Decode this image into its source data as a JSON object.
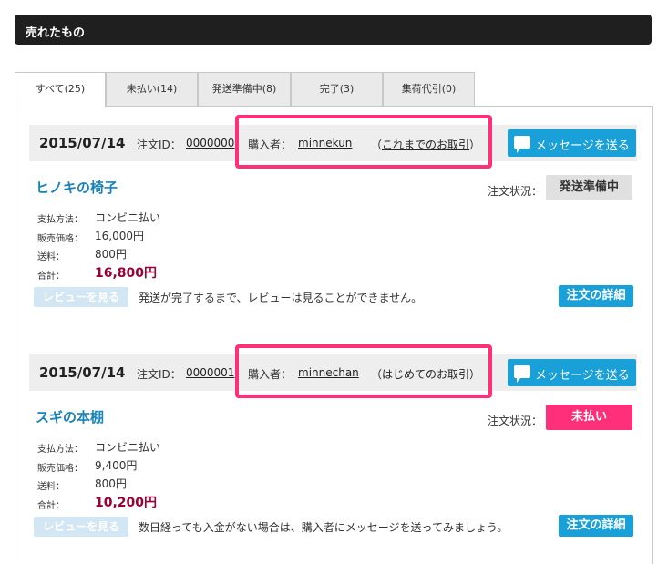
{
  "header": {
    "title": "売れたもの"
  },
  "tabs": [
    {
      "label": "すべて(25)",
      "active": true
    },
    {
      "label": "未払い(14)",
      "active": false
    },
    {
      "label": "発送準備中(8)",
      "active": false
    },
    {
      "label": "完了(3)",
      "active": false
    },
    {
      "label": "集荷代引(0)",
      "active": false
    }
  ],
  "labels": {
    "order_id": "注文ID：",
    "buyer": "購入者：",
    "message_button": "メッセージを送る",
    "status": "注文状況：",
    "payment_method": "支払方法：",
    "price": "販売価格：",
    "shipping": "送料：",
    "total": "合計：",
    "review_button": "レビューを見る",
    "detail_button": "注文の詳細"
  },
  "orders": [
    {
      "date": "2015/07/14",
      "order_id": "0000000",
      "buyer": "minnekun",
      "history_open": "（",
      "history_text": "これまでのお取引",
      "history_close": "）",
      "product": "ヒノキの椅子",
      "status": "発送準備中",
      "status_bg": "#e0e0e0",
      "status_fg": "#333333",
      "payment_method": "コンビニ払い",
      "price": "16,000円",
      "shipping": "800円",
      "total": "16,800円",
      "note": "発送が完了するまで、レビューは見ることができません。"
    },
    {
      "date": "2015/07/14",
      "order_id": "0000001",
      "buyer": "minnechan",
      "history_open": "（",
      "history_text": "はじめてのお取引",
      "history_close": "）",
      "product": "スギの本棚",
      "status": "未払い",
      "status_bg": "#ff2f79",
      "status_fg": "#ffffff",
      "payment_method": "コンビニ払い",
      "price": "9,400円",
      "shipping": "800円",
      "total": "10,200円",
      "note": "数日経っても入金がない場合は、購入者にメッセージを送ってみましょう。"
    }
  ],
  "colors": {
    "accent": "#1aa0d8",
    "highlight": "#ff2f79",
    "total": "#990033",
    "header_bg": "#1f1f1f"
  }
}
